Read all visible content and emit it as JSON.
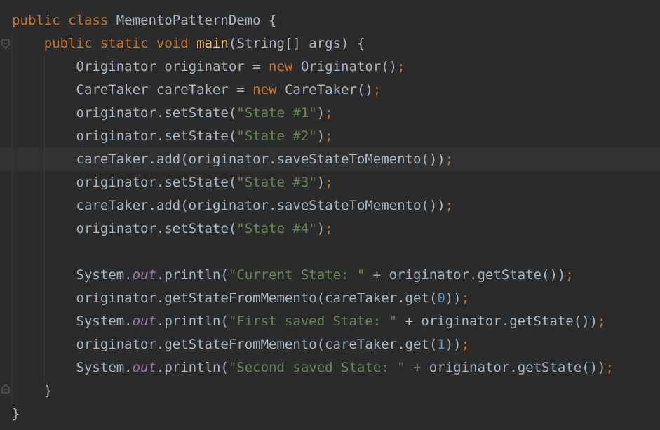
{
  "colors": {
    "background": "#2b2b2b",
    "current_line": "#323232",
    "default": "#a9b7c6",
    "keyword": "#cc7832",
    "string": "#6a8759",
    "number": "#6897bb",
    "static_field": "#9876aa",
    "method_declaration": "#ffc66d"
  },
  "lines": [
    [
      {
        "t": "public class ",
        "c": "kw"
      },
      {
        "t": "MementoPatternDemo {"
      }
    ],
    [
      {
        "t": "    "
      },
      {
        "t": "public static void ",
        "c": "kw"
      },
      {
        "t": "main",
        "c": "fn"
      },
      {
        "t": "(String[] args) {"
      }
    ],
    [
      {
        "t": "        Originator originator = "
      },
      {
        "t": "new ",
        "c": "kw"
      },
      {
        "t": "Originator()"
      },
      {
        "t": ";",
        "c": "kw"
      }
    ],
    [
      {
        "t": "        CareTaker careTaker = "
      },
      {
        "t": "new ",
        "c": "kw"
      },
      {
        "t": "CareTaker()"
      },
      {
        "t": ";",
        "c": "kw"
      }
    ],
    [
      {
        "t": "        originator.setState("
      },
      {
        "t": "\"State #1\"",
        "c": "str"
      },
      {
        "t": ")"
      },
      {
        "t": ";",
        "c": "kw"
      }
    ],
    [
      {
        "t": "        originator.setState("
      },
      {
        "t": "\"State #2\"",
        "c": "str"
      },
      {
        "t": ")"
      },
      {
        "t": ";",
        "c": "kw"
      }
    ],
    [
      {
        "t": "        careTaker.add(originator.saveStateToMemento())"
      },
      {
        "t": ";",
        "c": "kw"
      }
    ],
    [
      {
        "t": "        originator.setState("
      },
      {
        "t": "\"State #3\"",
        "c": "str"
      },
      {
        "t": ")"
      },
      {
        "t": ";",
        "c": "kw"
      }
    ],
    [
      {
        "t": "        careTaker.add(originator.saveStateToMemento())"
      },
      {
        "t": ";",
        "c": "kw"
      }
    ],
    [
      {
        "t": "        originator.setState("
      },
      {
        "t": "\"State #4\"",
        "c": "str"
      },
      {
        "t": ")"
      },
      {
        "t": ";",
        "c": "kw"
      }
    ],
    [],
    [
      {
        "t": "        System."
      },
      {
        "t": "out",
        "c": "fld"
      },
      {
        "t": ".println("
      },
      {
        "t": "\"Current State: \"",
        "c": "str"
      },
      {
        "t": " + originator.getState())"
      },
      {
        "t": ";",
        "c": "kw"
      }
    ],
    [
      {
        "t": "        originator.getStateFromMemento(careTaker.get("
      },
      {
        "t": "0",
        "c": "num"
      },
      {
        "t": "))"
      },
      {
        "t": ";",
        "c": "kw"
      }
    ],
    [
      {
        "t": "        System."
      },
      {
        "t": "out",
        "c": "fld"
      },
      {
        "t": ".println("
      },
      {
        "t": "\"First saved State: \"",
        "c": "str"
      },
      {
        "t": " + originator.getState())"
      },
      {
        "t": ";",
        "c": "kw"
      }
    ],
    [
      {
        "t": "        originator.getStateFromMemento(careTaker.get("
      },
      {
        "t": "1",
        "c": "num"
      },
      {
        "t": "))"
      },
      {
        "t": ";",
        "c": "kw"
      }
    ],
    [
      {
        "t": "        System."
      },
      {
        "t": "out",
        "c": "fld"
      },
      {
        "t": ".println("
      },
      {
        "t": "\"Second saved State: \"",
        "c": "str"
      },
      {
        "t": " + originator.getState())"
      },
      {
        "t": ";",
        "c": "kw"
      }
    ],
    [
      {
        "t": "    }"
      }
    ],
    [
      {
        "t": "}"
      }
    ]
  ]
}
